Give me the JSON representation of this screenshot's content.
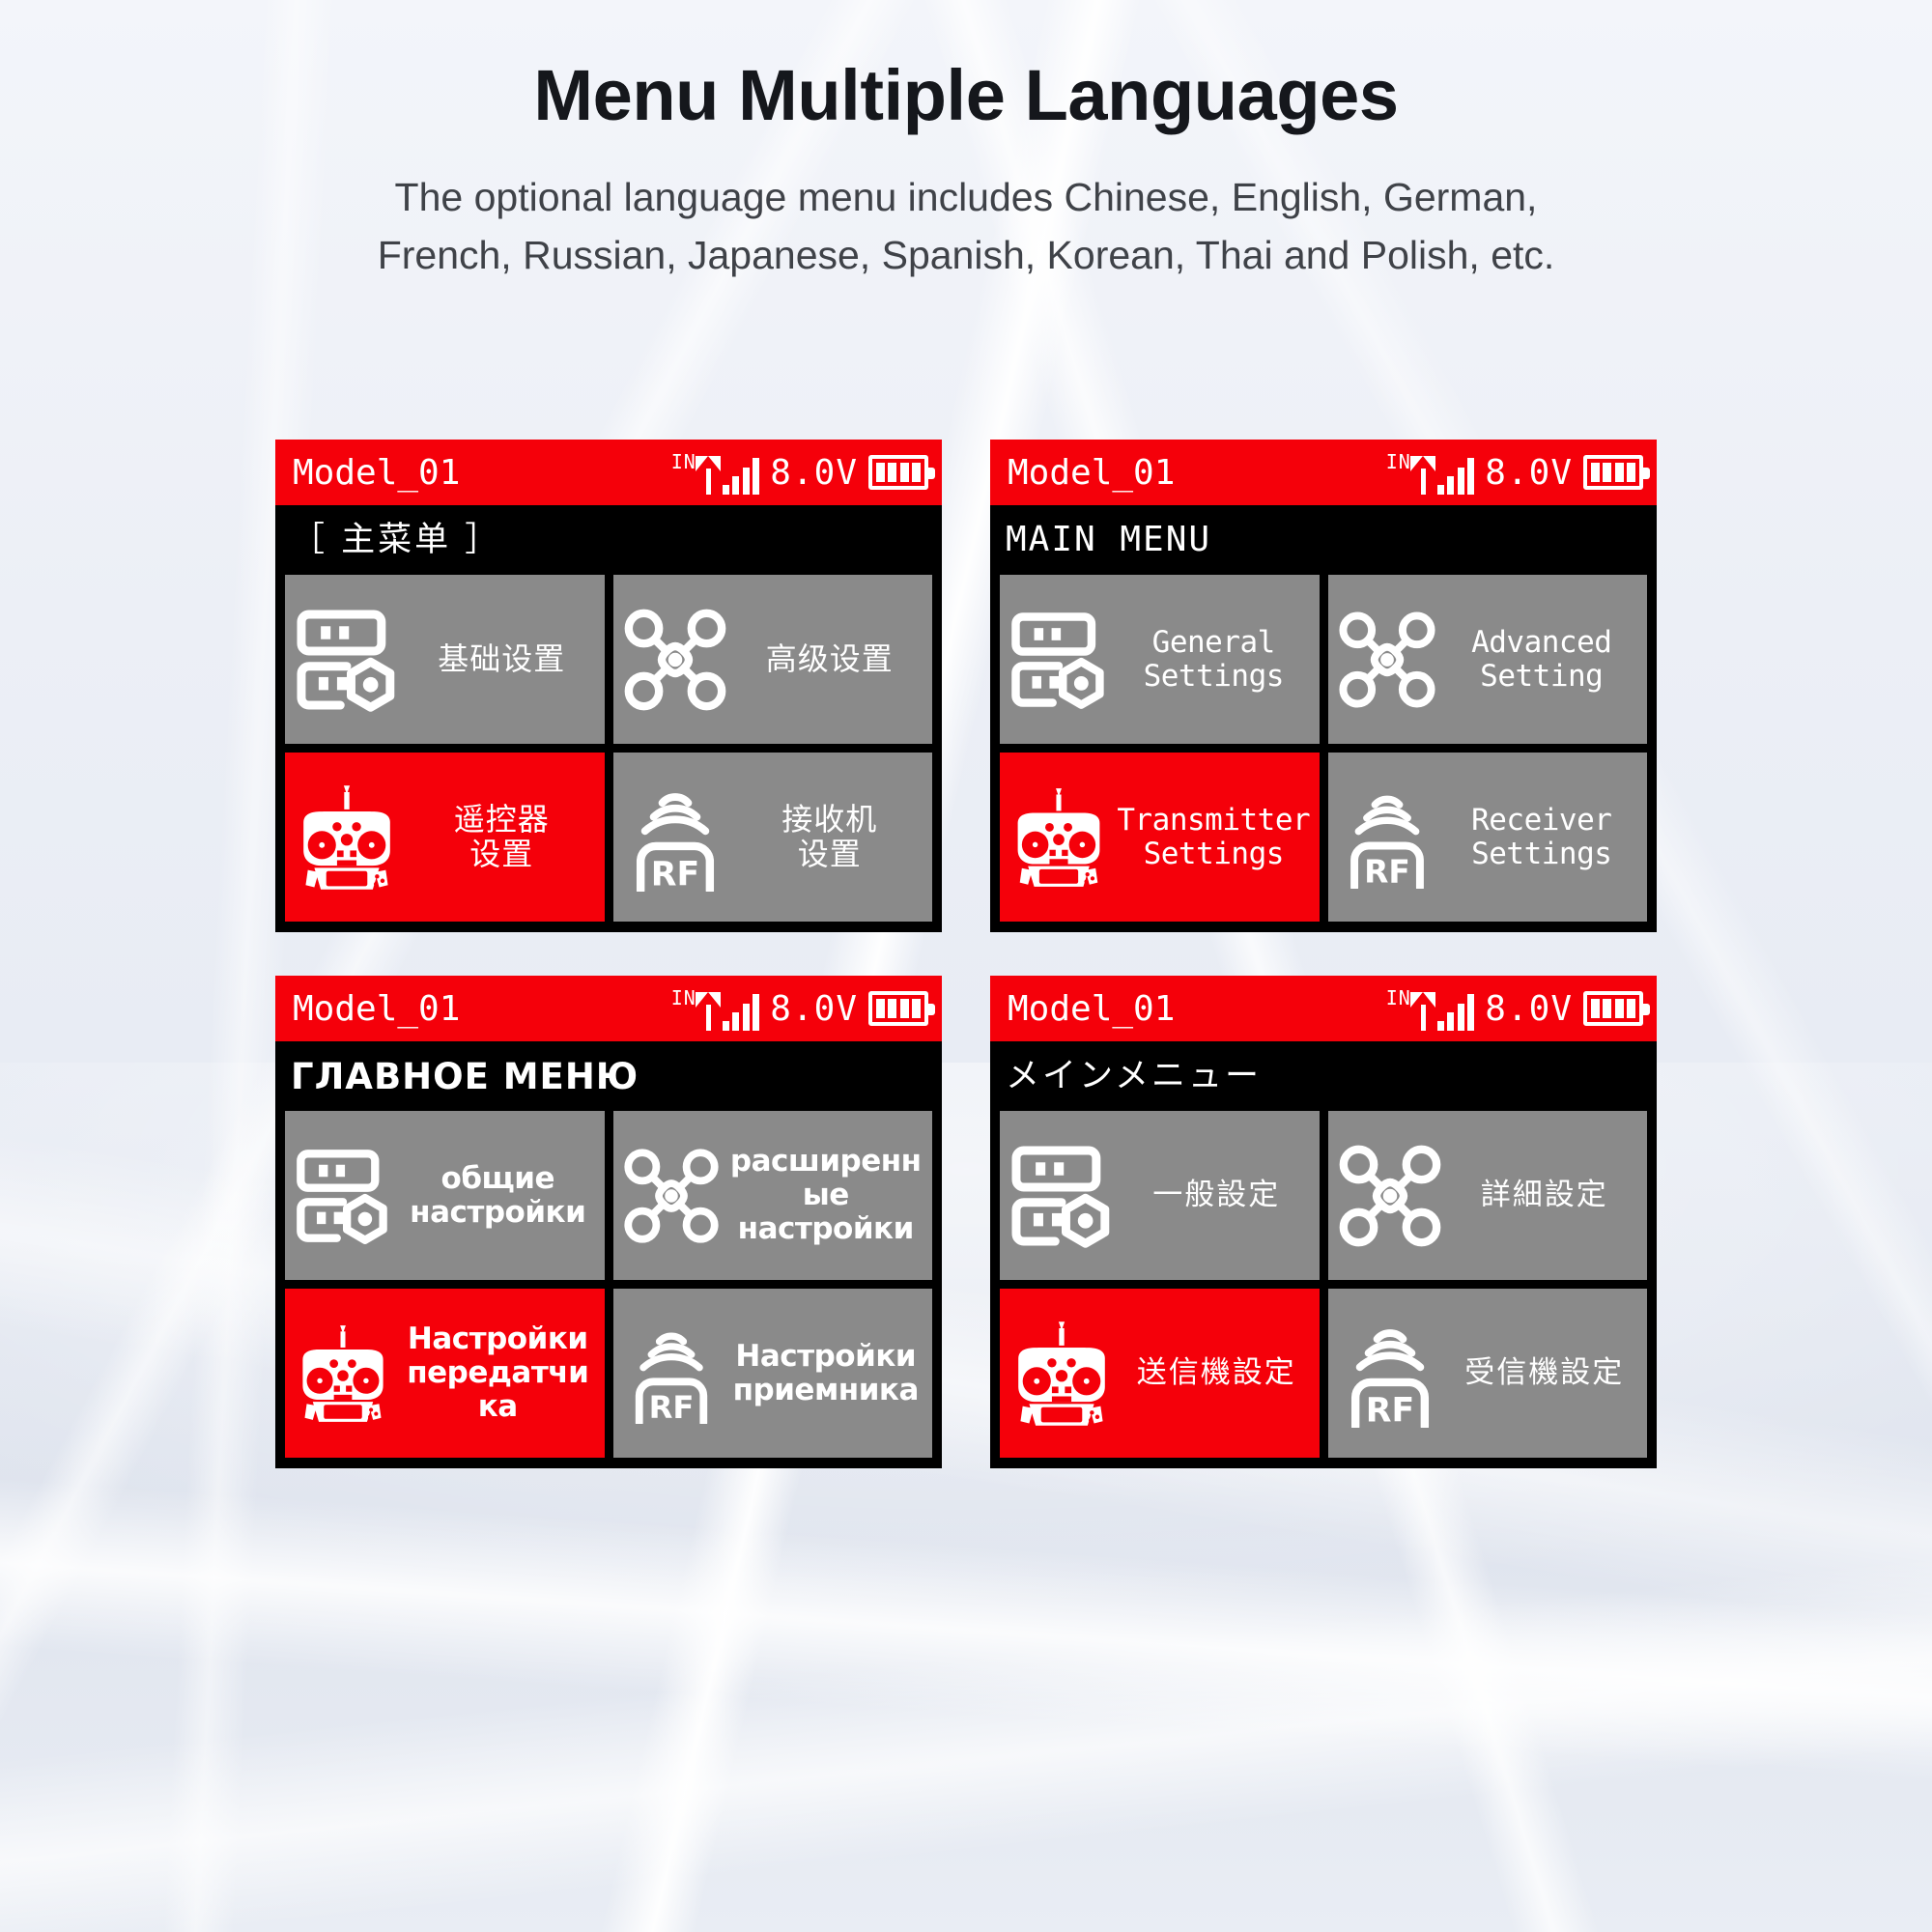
{
  "header": {
    "title": "Menu Multiple Languages",
    "subtitle_line1": "The optional language menu includes Chinese, English, German,",
    "subtitle_line2": "French, Russian, Japanese, Spanish, Korean, Thai and Polish, etc."
  },
  "colors": {
    "accent_red": "#f5000a",
    "tile_gray": "#8a8a8a",
    "screen_black": "#000000",
    "text_white": "#ffffff",
    "title_black": "#15171c"
  },
  "status_bar": {
    "model_name": "Model_01",
    "network_label": "IN",
    "signal_bars": 4,
    "voltage": "8.0V",
    "battery_segments": 4
  },
  "screens": [
    {
      "lang": "zh",
      "menu_title": "［ 主菜单 ］",
      "tiles": [
        {
          "icon": "general-settings-icon",
          "label": "基础设置",
          "selected": false
        },
        {
          "icon": "drone-icon",
          "label": "高级设置",
          "selected": false
        },
        {
          "icon": "transmitter-icon",
          "label": "遥控器\n设置",
          "selected": true
        },
        {
          "icon": "rf-receiver-icon",
          "label": "接收机\n设置",
          "selected": false
        }
      ]
    },
    {
      "lang": "en",
      "menu_title": "MAIN MENU",
      "tiles": [
        {
          "icon": "general-settings-icon",
          "label": "General\nSettings",
          "selected": false
        },
        {
          "icon": "drone-icon",
          "label": "Advanced\nSetting",
          "selected": false
        },
        {
          "icon": "transmitter-icon",
          "label": "Transmitter\nSettings",
          "selected": true
        },
        {
          "icon": "rf-receiver-icon",
          "label": "Receiver\nSettings",
          "selected": false
        }
      ]
    },
    {
      "lang": "ru",
      "menu_title": "ГЛАВНОЕ МЕНЮ",
      "tiles": [
        {
          "icon": "general-settings-icon",
          "label": "общие\nнастройки",
          "selected": false
        },
        {
          "icon": "drone-icon",
          "label": "расширенн\nые\nнастройки",
          "selected": false
        },
        {
          "icon": "transmitter-icon",
          "label": "Настройки\nпередатчи\nка",
          "selected": true
        },
        {
          "icon": "rf-receiver-icon",
          "label": "Настройки\nприемника",
          "selected": false
        }
      ]
    },
    {
      "lang": "ja",
      "menu_title": "メインメニュー",
      "tiles": [
        {
          "icon": "general-settings-icon",
          "label": "一般設定",
          "selected": false
        },
        {
          "icon": "drone-icon",
          "label": "詳細設定",
          "selected": false
        },
        {
          "icon": "transmitter-icon",
          "label": "送信機設定",
          "selected": true
        },
        {
          "icon": "rf-receiver-icon",
          "label": "受信機設定",
          "selected": false
        }
      ]
    }
  ]
}
